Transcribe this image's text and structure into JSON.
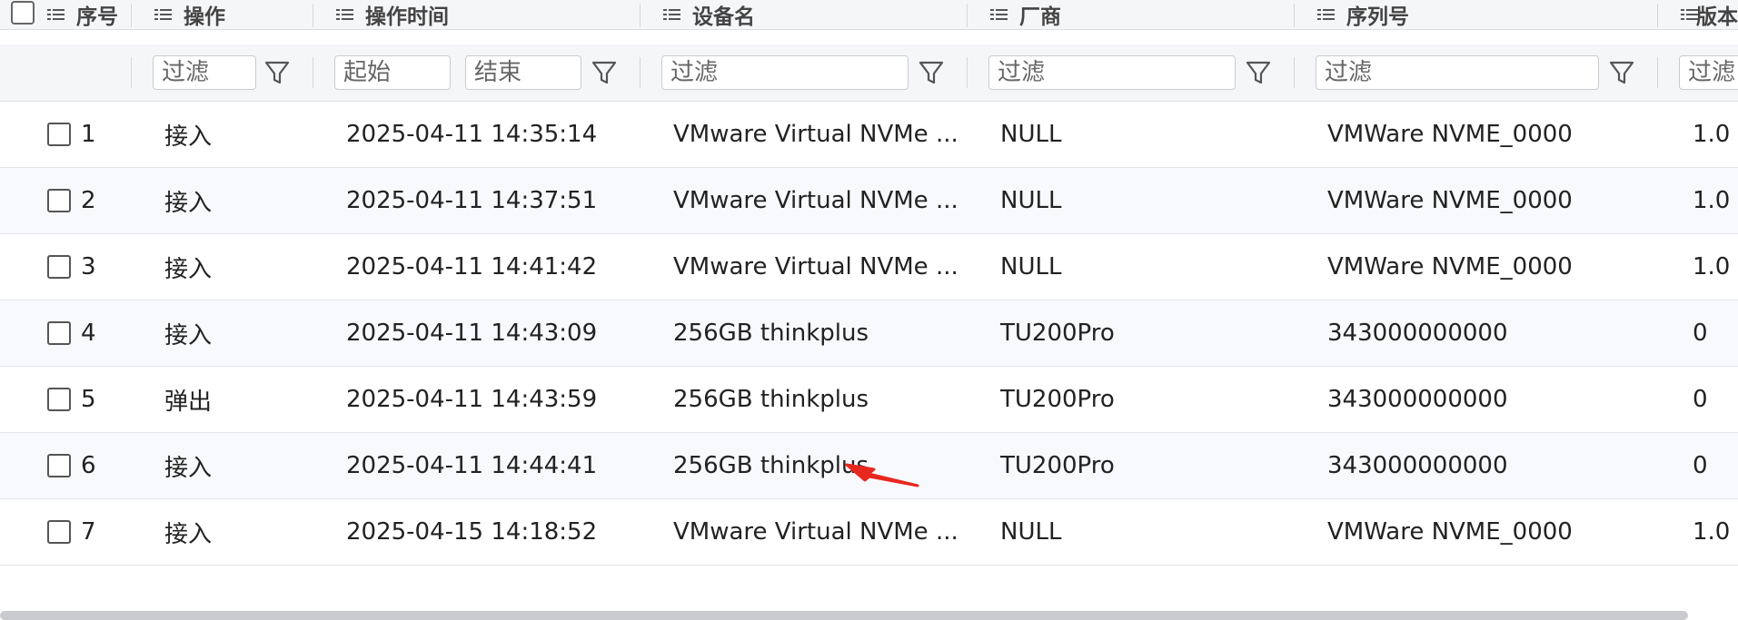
{
  "table": {
    "columns": [
      {
        "key": "seq",
        "label": "序号"
      },
      {
        "key": "action",
        "label": "操作"
      },
      {
        "key": "time",
        "label": "操作时间"
      },
      {
        "key": "device",
        "label": "设备名"
      },
      {
        "key": "vendor",
        "label": "厂商"
      },
      {
        "key": "serial",
        "label": "序列号"
      },
      {
        "key": "version",
        "label": "版本"
      }
    ],
    "filters": {
      "action_placeholder": "过滤",
      "time_start_placeholder": "起始",
      "time_end_placeholder": "结束",
      "device_placeholder": "过滤",
      "vendor_placeholder": "过滤",
      "serial_placeholder": "过滤",
      "version_placeholder": "过滤"
    },
    "rows": [
      {
        "seq": "1",
        "action": "接入",
        "time": "2025-04-11 14:35:14",
        "device": "VMware Virtual NVMe ...",
        "vendor": "NULL",
        "serial": "VMWare NVME_0000",
        "version": "1.0"
      },
      {
        "seq": "2",
        "action": "接入",
        "time": "2025-04-11 14:37:51",
        "device": "VMware Virtual NVMe ...",
        "vendor": "NULL",
        "serial": "VMWare NVME_0000",
        "version": "1.0"
      },
      {
        "seq": "3",
        "action": "接入",
        "time": "2025-04-11 14:41:42",
        "device": "VMware Virtual NVMe ...",
        "vendor": "NULL",
        "serial": "VMWare NVME_0000",
        "version": "1.0"
      },
      {
        "seq": "4",
        "action": "接入",
        "time": "2025-04-11 14:43:09",
        "device": "256GB thinkplus",
        "vendor": "TU200Pro",
        "serial": "343000000000",
        "version": "0"
      },
      {
        "seq": "5",
        "action": "弹出",
        "time": "2025-04-11 14:43:59",
        "device": "256GB thinkplus",
        "vendor": "TU200Pro",
        "serial": "343000000000",
        "version": "0"
      },
      {
        "seq": "6",
        "action": "接入",
        "time": "2025-04-11 14:44:41",
        "device": "256GB thinkplus",
        "vendor": "TU200Pro",
        "serial": "343000000000",
        "version": "0"
      },
      {
        "seq": "7",
        "action": "接入",
        "time": "2025-04-15 14:18:52",
        "device": "VMware Virtual NVMe ...",
        "vendor": "NULL",
        "serial": "VMWare NVME_0000",
        "version": "1.0"
      }
    ]
  },
  "colors": {
    "header_bg": "#f5f6f8",
    "alt_row_bg": "#f8f9fc",
    "annotation_arrow": "#e8281e"
  },
  "icons": {
    "column_menu": "list-icon",
    "filter": "funnel-icon",
    "select": "checkbox-icon"
  }
}
